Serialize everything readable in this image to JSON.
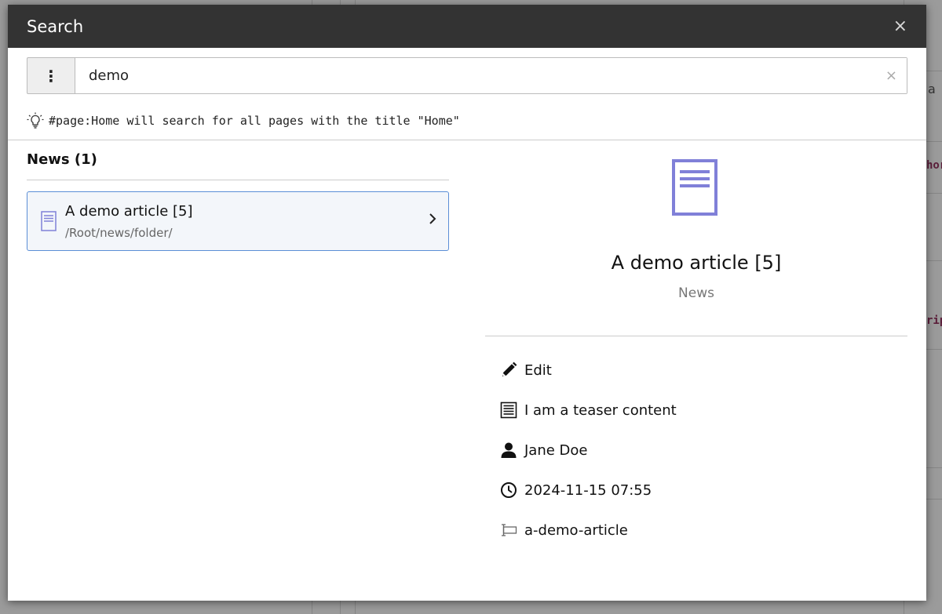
{
  "modal": {
    "title": "Search",
    "close": "×"
  },
  "search": {
    "menu_glyph": "⋮",
    "value": "demo",
    "clear": "×",
    "hint": "#page:Home will search for all pages with the title \"Home\""
  },
  "results": {
    "group_title": "News (1)",
    "items": [
      {
        "title": "A demo article [5]",
        "path": "/Root/news/folder/"
      }
    ]
  },
  "preview": {
    "title": "A demo article [5]",
    "type": "News",
    "details": {
      "edit": "Edit",
      "teaser": "I am a teaser content",
      "author": "Jane Doe",
      "datetime": "2024-11-15 07:55",
      "slug": "a-demo-article"
    }
  },
  "background": {
    "frag1": "a",
    "frag2": "hor",
    "frag3": "rip"
  },
  "colors": {
    "header_bg": "#333333",
    "accent": "#5b8ed6",
    "doc_icon": "#8080d8",
    "result_bg": "#f3f6fa"
  }
}
